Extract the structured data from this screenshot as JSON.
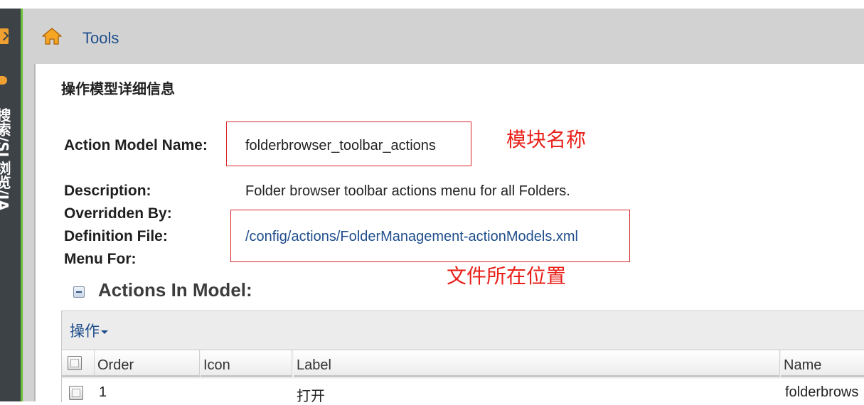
{
  "sidebar": {
    "vertical_text": "搜索/SL浏览/IA"
  },
  "header": {
    "breadcrumb": "Tools"
  },
  "page": {
    "title": "操作模型详细信息"
  },
  "details": {
    "name_label": "Action Model Name:",
    "name_value": "folderbrowser_toolbar_actions",
    "description_label": "Description:",
    "description_value": "Folder browser toolbar actions menu for all Folders.",
    "overridden_label": "Overridden By:",
    "definition_label": "Definition File:",
    "definition_value": "/config/actions/FolderManagement-actionModels.xml",
    "menu_for_label": "Menu For:"
  },
  "annotations": {
    "module_name": "模块名称",
    "file_location": "文件所在位置"
  },
  "section": {
    "title": "Actions In Model:"
  },
  "grid": {
    "ops_menu": "操作",
    "columns": [
      "Order",
      "Icon",
      "Label",
      "Name"
    ],
    "rows": [
      {
        "order": "1",
        "icon": "",
        "label": "打开",
        "name": "folderbrows"
      }
    ]
  },
  "colors": {
    "annotation_red": "#e8211a",
    "link_blue": "#1f4e8c",
    "sidebar_accent": "#6cbf3a"
  }
}
